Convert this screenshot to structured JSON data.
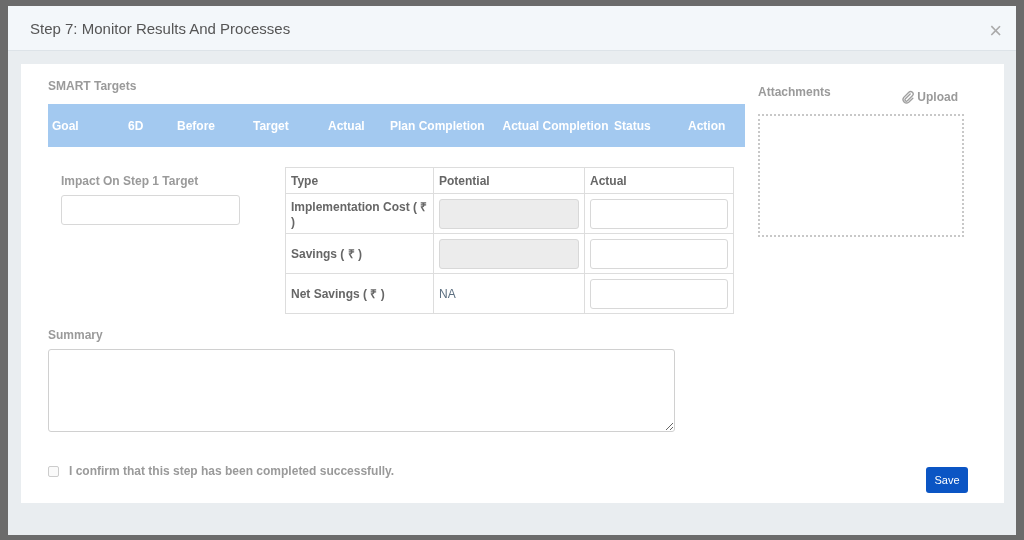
{
  "dialog": {
    "title": "Step 7: Monitor Results And Processes",
    "close": "×"
  },
  "smart_targets": {
    "title": "SMART Targets",
    "columns": [
      "Goal",
      "6D",
      "Before",
      "Target",
      "Actual",
      "Plan Completion",
      "Actual Completion",
      "Status",
      "Action"
    ]
  },
  "impact": {
    "label": "Impact On Step 1 Target"
  },
  "savings_table": {
    "columns": [
      "Type",
      "Potential",
      "Actual"
    ],
    "rows": [
      {
        "type": "Implementation Cost ( ₹ )",
        "potential": {
          "kind": "field",
          "disabled": true
        },
        "actual": {
          "kind": "field",
          "disabled": false
        }
      },
      {
        "type": "Savings ( ₹ )",
        "potential": {
          "kind": "field",
          "disabled": true
        },
        "actual": {
          "kind": "field",
          "disabled": false
        }
      },
      {
        "type": "Net Savings ( ₹ )",
        "potential": {
          "kind": "text",
          "text": "NA"
        },
        "actual": {
          "kind": "field",
          "disabled": false
        }
      }
    ]
  },
  "summary": {
    "label": "Summary"
  },
  "attachments": {
    "title": "Attachments",
    "upload": "Upload"
  },
  "confirm": {
    "label": "I confirm that this step has been completed successfully.",
    "checked": false
  },
  "save_button": "Save"
}
